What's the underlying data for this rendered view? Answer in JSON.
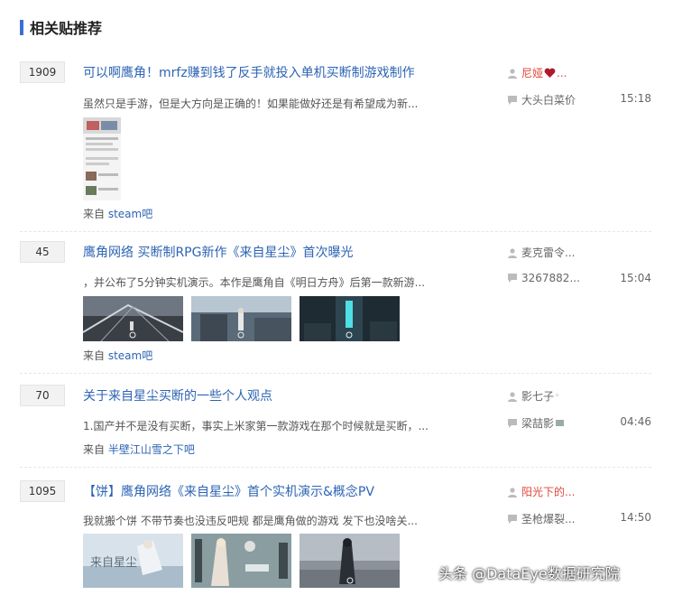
{
  "section": {
    "title": "相关贴推荐"
  },
  "posts": [
    {
      "replies": "1909",
      "title": "可以啊鹰角！mrfz赚到钱了反手就投入单机买断制游戏制作",
      "desc": "虽然只是手游，但是大方向是正确的！如果能做好还是有希望成为新...",
      "from_prefix": "来自",
      "from_forum": "steam吧",
      "author": "尼娅",
      "last_reply_user": "大头白菜价",
      "time": "15:18"
    },
    {
      "replies": "45",
      "title": "鹰角网络 买断制RPG新作《来自星尘》首次曝光",
      "desc": "，并公布了5分钟实机演示。本作是鹰角自《明日方舟》后第一款新游...",
      "from_prefix": "来自",
      "from_forum": "steam吧",
      "author": "麦克雷令...",
      "last_reply_user": "3267882...",
      "time": "15:04"
    },
    {
      "replies": "70",
      "title": "关于来自星尘买断的一些个人观点",
      "desc": "1.国产并不是没有买断，事实上米家第一款游戏在那个时候就是买断，...",
      "from_prefix": "来自",
      "from_forum": "半壁江山雪之下吧",
      "author": "影七子",
      "last_reply_user": "梁喆影",
      "time": "04:46"
    },
    {
      "replies": "1095",
      "title": "【饼】鹰角网络《来自星尘》首个实机演示&概念PV",
      "desc": "我就搬个饼 不带节奏也没违反吧规 都是鹰角做的游戏 发下也没啥关...",
      "author": "阳光下的...",
      "last_reply_user": "圣枪爆裂...",
      "time": "14:50"
    }
  ],
  "thumb4_text": "来自星尘",
  "watermark": "头条 @DataEye数据研究院",
  "colors": {
    "accent": "#3b6fd6",
    "link": "#2d64b3",
    "author_red": "#e0483c"
  }
}
